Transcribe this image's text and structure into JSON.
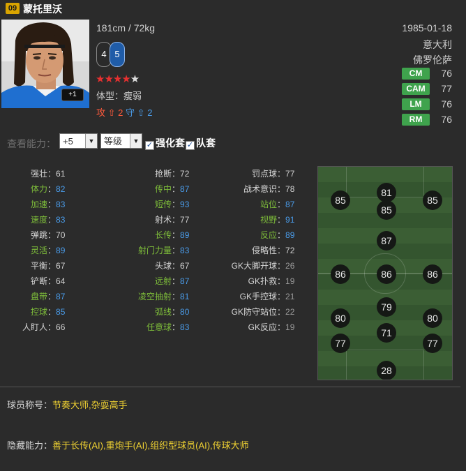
{
  "player": {
    "season": "09",
    "name": "蒙托里沃",
    "height_weight": "181cm / 72kg",
    "weak_foot": "4",
    "strong_foot": "5",
    "stars_on": 4,
    "stars_total": 5,
    "star_on": "★★★★",
    "star_off": "★",
    "plus_tag": "+1",
    "body_type": "体型：瘦弱",
    "attack_label": "攻",
    "attack_value": "2",
    "defense_label": "守",
    "defense_value": "2",
    "birth": "1985-01-18",
    "nation": "意大利",
    "club": "佛罗伦萨"
  },
  "positions": [
    {
      "pos": "CM",
      "val": "76"
    },
    {
      "pos": "CAM",
      "val": "77"
    },
    {
      "pos": "LM",
      "val": "76"
    },
    {
      "pos": "RM",
      "val": "76"
    }
  ],
  "controls": {
    "label": "查看能力：",
    "level_select": "+5",
    "grade_select": "等级",
    "check1": "强化套",
    "check2": "队套"
  },
  "stats": {
    "col1": [
      {
        "k": "强壮",
        "v": "61",
        "c": "white"
      },
      {
        "k": "体力",
        "v": "82",
        "c": "gblue"
      },
      {
        "k": "加速",
        "v": "83",
        "c": "gblue"
      },
      {
        "k": "速度",
        "v": "83",
        "c": "gblue"
      },
      {
        "k": "弹跳",
        "v": "70",
        "c": "white"
      },
      {
        "k": "灵活",
        "v": "89",
        "c": "gblue"
      },
      {
        "k": "平衡",
        "v": "67",
        "c": "white"
      },
      {
        "k": "铲断",
        "v": "64",
        "c": "white"
      },
      {
        "k": "盘带",
        "v": "87",
        "c": "gblue"
      },
      {
        "k": "控球",
        "v": "85",
        "c": "gblue"
      },
      {
        "k": "人盯人",
        "v": "66",
        "c": "white"
      }
    ],
    "col2": [
      {
        "k": "抢断",
        "v": "72",
        "c": "white"
      },
      {
        "k": "传中",
        "v": "87",
        "c": "gblue"
      },
      {
        "k": "短传",
        "v": "93",
        "c": "gblue"
      },
      {
        "k": "射术",
        "v": "77",
        "c": "white"
      },
      {
        "k": "长传",
        "v": "89",
        "c": "gblue"
      },
      {
        "k": "射门力量",
        "v": "83",
        "c": "gblue"
      },
      {
        "k": "头球",
        "v": "67",
        "c": "white"
      },
      {
        "k": "远射",
        "v": "87",
        "c": "gblue"
      },
      {
        "k": "凌空抽射",
        "v": "81",
        "c": "gblue"
      },
      {
        "k": "弧线",
        "v": "80",
        "c": "gblue"
      },
      {
        "k": "任意球",
        "v": "83",
        "c": "gblue"
      }
    ],
    "col3": [
      {
        "k": "罚点球",
        "v": "77",
        "c": "white"
      },
      {
        "k": "战术意识",
        "v": "78",
        "c": "white"
      },
      {
        "k": "站位",
        "v": "87",
        "c": "gblue"
      },
      {
        "k": "视野",
        "v": "91",
        "c": "gblue"
      },
      {
        "k": "反应",
        "v": "89",
        "c": "gblue"
      },
      {
        "k": "侵略性",
        "v": "72",
        "c": "white"
      },
      {
        "k": "GK大脚开球",
        "v": "26",
        "c": "gk"
      },
      {
        "k": "GK扑救",
        "v": "19",
        "c": "gk"
      },
      {
        "k": "GK手控球",
        "v": "21",
        "c": "gk"
      },
      {
        "k": "GK防守站位",
        "v": "22",
        "c": "gk"
      },
      {
        "k": "GK反应",
        "v": "19",
        "c": "gk"
      }
    ]
  },
  "pitch_ratings": [
    {
      "name": "left-wing",
      "v": "85"
    },
    {
      "name": "striker",
      "v": "81"
    },
    {
      "name": "right-wing",
      "v": "85"
    },
    {
      "name": "center-forward",
      "v": "85"
    },
    {
      "name": "attacking-mid",
      "v": "87"
    },
    {
      "name": "left-mid",
      "v": "86"
    },
    {
      "name": "center-mid",
      "v": "86"
    },
    {
      "name": "right-mid",
      "v": "86"
    },
    {
      "name": "defensive-mid",
      "v": "79"
    },
    {
      "name": "left-wingback",
      "v": "80"
    },
    {
      "name": "right-wingback",
      "v": "80"
    },
    {
      "name": "left-back",
      "v": "77"
    },
    {
      "name": "center-back",
      "v": "71"
    },
    {
      "name": "right-back",
      "v": "77"
    },
    {
      "name": "goalkeeper",
      "v": "28"
    }
  ],
  "bottom": {
    "nickname_label": "球员称号：",
    "nickname_value": "节奏大师,杂耍高手",
    "hidden_label": "隐藏能力：",
    "hidden_value": "善于长传(AI),重炮手(AI),组织型球员(AI),传球大师"
  },
  "colors": {
    "position_badge": "#3fa34d",
    "attack": "#ff5a3c",
    "defense": "#4a9be8",
    "highlight_yellow": "#f0d232",
    "star_on": "#e53030"
  }
}
